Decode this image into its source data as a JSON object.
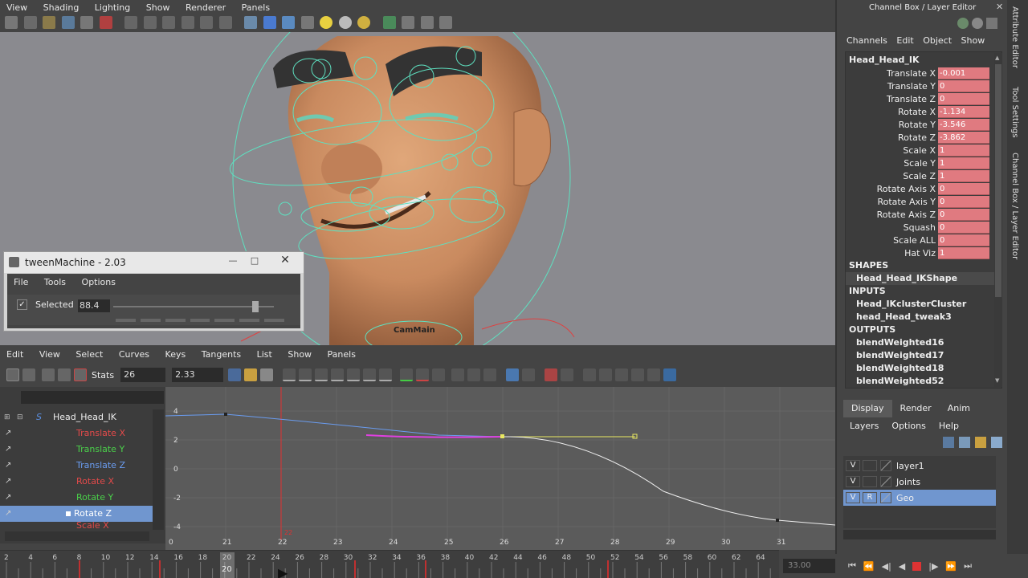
{
  "viewport": {
    "menu": [
      "View",
      "Shading",
      "Lighting",
      "Show",
      "Renderer",
      "Panels"
    ],
    "camera_label": "CamMain"
  },
  "tween": {
    "title": "tweenMachine - 2.03",
    "menu": [
      "File",
      "Tools",
      "Options"
    ],
    "selected_label": "Selected",
    "value": "88.4",
    "slider_fraction": 0.884
  },
  "graph_editor": {
    "menu": [
      "Edit",
      "View",
      "Select",
      "Curves",
      "Keys",
      "Tangents",
      "List",
      "Show",
      "Panels"
    ],
    "stats_label": "Stats",
    "stats_frame": "26",
    "stats_value": "2.33",
    "outliner": {
      "node": "Head_Head_IK",
      "attrs": [
        {
          "label": "Translate X",
          "color": "#e34a4a"
        },
        {
          "label": "Translate Y",
          "color": "#4ad04a"
        },
        {
          "label": "Translate Z",
          "color": "#6a9cf0"
        },
        {
          "label": "Rotate X",
          "color": "#e34a4a"
        },
        {
          "label": "Rotate Y",
          "color": "#4ad04a"
        },
        {
          "label": "Rotate Z",
          "color": "#ffffff"
        }
      ],
      "partial_attr": "Scale X"
    },
    "y_ticks": [
      "4",
      "2",
      "0",
      "-2",
      "-4"
    ],
    "x_ticks": [
      "0",
      "21",
      "22",
      "23",
      "24",
      "25",
      "26",
      "27",
      "28",
      "29",
      "30",
      "31"
    ],
    "current_frame_label": "22"
  },
  "timeline": {
    "ticks": [
      "2",
      "4",
      "6",
      "8",
      "10",
      "12",
      "14",
      "16",
      "18",
      "20",
      "22",
      "24",
      "26",
      "28",
      "30",
      "32",
      "34",
      "36",
      "38",
      "40",
      "42",
      "44",
      "46",
      "48",
      "50",
      "52",
      "54",
      "56",
      "58",
      "60",
      "62",
      "64"
    ],
    "current_frame": "20",
    "time_field": "33.00"
  },
  "channel_box": {
    "title": "Channel Box / Layer Editor",
    "menu": [
      "Channels",
      "Edit",
      "Object",
      "Show"
    ],
    "node": "Head_Head_IK",
    "attributes": [
      {
        "label": "Translate X",
        "value": "-0.001"
      },
      {
        "label": "Translate Y",
        "value": "0"
      },
      {
        "label": "Translate Z",
        "value": "0"
      },
      {
        "label": "Rotate X",
        "value": "-1.134"
      },
      {
        "label": "Rotate Y",
        "value": "-3.546"
      },
      {
        "label": "Rotate Z",
        "value": "-3.862"
      },
      {
        "label": "Scale X",
        "value": "1"
      },
      {
        "label": "Scale Y",
        "value": "1"
      },
      {
        "label": "Scale Z",
        "value": "1"
      },
      {
        "label": "Rotate Axis X",
        "value": "0"
      },
      {
        "label": "Rotate Axis Y",
        "value": "0"
      },
      {
        "label": "Rotate Axis Z",
        "value": "0"
      },
      {
        "label": "Squash",
        "value": "0"
      },
      {
        "label": "Scale ALL",
        "value": "0"
      },
      {
        "label": "Hat Viz",
        "value": "1"
      }
    ],
    "shapes_label": "SHAPES",
    "shape": "Head_Head_IKShape",
    "inputs_label": "INPUTS",
    "inputs": [
      "Head_IKclusterCluster",
      "head_Head_tweak3"
    ],
    "outputs_label": "OUTPUTS",
    "outputs": [
      "blendWeighted16",
      "blendWeighted17",
      "blendWeighted18",
      "blendWeighted52"
    ]
  },
  "layer_editor": {
    "tabs": [
      "Display",
      "Render",
      "Anim"
    ],
    "menu": [
      "Layers",
      "Options",
      "Help"
    ],
    "layers": [
      {
        "v": "V",
        "r": "",
        "name": "layer1"
      },
      {
        "v": "V",
        "r": "",
        "name": "Joints"
      },
      {
        "v": "V",
        "r": "R",
        "name": "Geo"
      }
    ]
  },
  "side_tabs": [
    "Attribute Editor",
    "Tool Settings",
    "Channel Box / Layer Editor"
  ]
}
